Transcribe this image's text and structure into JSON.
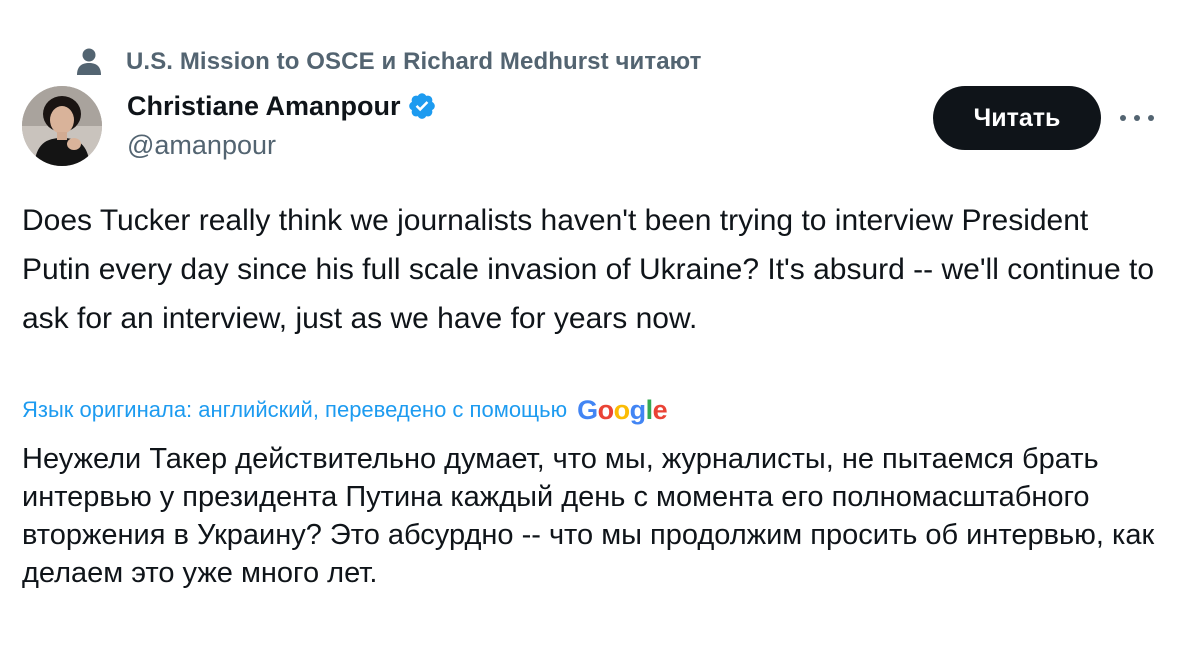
{
  "social_context": {
    "text": "U.S. Mission to OSCE и Richard Medhurst читают",
    "icon": "person-icon"
  },
  "author": {
    "name": "Christiane Amanpour",
    "handle": "@amanpour",
    "verified": true,
    "verified_color": "#1d9bf0"
  },
  "actions": {
    "follow_label": "Читать",
    "more_icon": "more-horizontal-icon"
  },
  "tweet": {
    "text": "Does Tucker really think we journalists haven't been trying to interview President Putin every day since his full scale invasion of Ukraine? It's absurd -- we'll continue to ask for an interview, just as we have for years now."
  },
  "translation": {
    "label": "Язык оригинала: английский, переведено с помощью",
    "provider_logo": "Google",
    "text": "Неужели Такер действительно думает, что мы, журналисты, не пытаемся брать интервью у президента Путина каждый день с момента его полномасштабного вторжения в Украину? Это абсурдно -- что мы продолжим просить об интервью, как делаем это уже много лет."
  },
  "colors": {
    "text_primary": "#0f1419",
    "text_secondary": "#536471",
    "accent": "#1d9bf0",
    "button_bg": "#0f1419",
    "button_text": "#ffffff"
  }
}
